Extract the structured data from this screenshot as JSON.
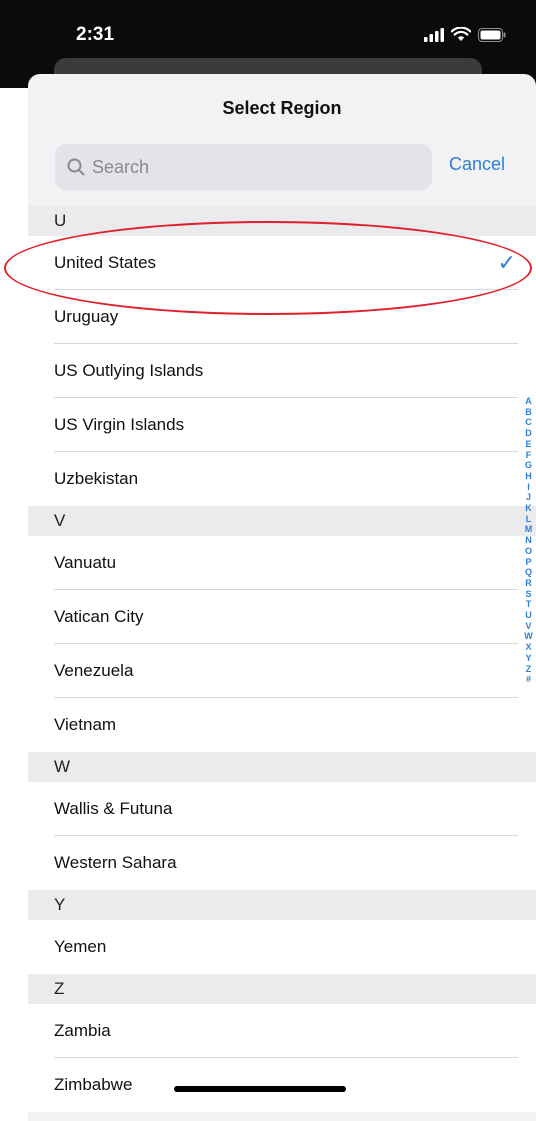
{
  "status_bar": {
    "time": "2:31"
  },
  "sheet": {
    "title": "Select Region",
    "search_placeholder": "Search",
    "cancel_label": "Cancel"
  },
  "sections": [
    {
      "header": "U",
      "items": [
        "United States",
        "Uruguay",
        "US Outlying Islands",
        "US Virgin Islands",
        "Uzbekistan"
      ]
    },
    {
      "header": "V",
      "items": [
        "Vanuatu",
        "Vatican City",
        "Venezuela",
        "Vietnam"
      ]
    },
    {
      "header": "W",
      "items": [
        "Wallis & Futuna",
        "Western Sahara"
      ]
    },
    {
      "header": "Y",
      "items": [
        "Yemen"
      ]
    },
    {
      "header": "Z",
      "items": [
        "Zambia",
        "Zimbabwe"
      ]
    }
  ],
  "selected_item": "United States",
  "checkmark_glyph": "✓",
  "index_letters": [
    "A",
    "B",
    "C",
    "D",
    "E",
    "F",
    "G",
    "H",
    "I",
    "J",
    "K",
    "L",
    "M",
    "N",
    "O",
    "P",
    "Q",
    "R",
    "S",
    "T",
    "U",
    "V",
    "W",
    "X",
    "Y",
    "Z",
    "#"
  ],
  "colors": {
    "accent": "#2f7fd6",
    "highlight": "#e0202a"
  }
}
